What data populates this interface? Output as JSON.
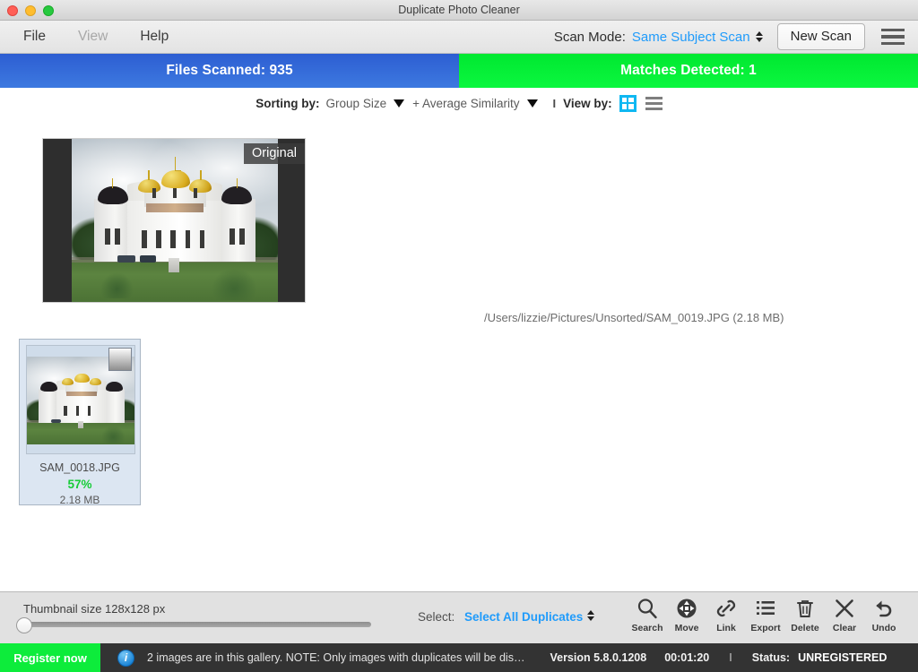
{
  "window": {
    "title": "Duplicate Photo Cleaner"
  },
  "menu": {
    "items": [
      {
        "label": "File",
        "disabled": false
      },
      {
        "label": "View",
        "disabled": true
      },
      {
        "label": "Help",
        "disabled": false
      }
    ],
    "scan_mode_label": "Scan Mode:",
    "scan_mode_value": "Same Subject Scan",
    "new_scan_label": "New Scan"
  },
  "stats": {
    "files_scanned": "Files Scanned: 935",
    "matches_detected": "Matches Detected: 1"
  },
  "sorting": {
    "sorting_label": "Sorting by:",
    "primary": "Group Size",
    "secondary": "+ Average Similarity",
    "separator": "I",
    "view_label": "View by:"
  },
  "preview": {
    "badge": "Original",
    "file_path": "/Users/lizzie/Pictures/Unsorted/SAM_0019.JPG (2.18 MB)"
  },
  "thumbnails": [
    {
      "name": "SAM_0018.JPG",
      "similarity": "57%",
      "size": "2.18 MB"
    }
  ],
  "bottom": {
    "thumbnail_size_label": "Thumbnail size 128x128 px",
    "select_label": "Select:",
    "select_value": "Select All Duplicates",
    "tools": [
      {
        "label": "Search",
        "icon": "search-icon"
      },
      {
        "label": "Move",
        "icon": "move-icon"
      },
      {
        "label": "Link",
        "icon": "link-icon"
      },
      {
        "label": "Export",
        "icon": "export-icon"
      },
      {
        "label": "Delete",
        "icon": "trash-icon"
      },
      {
        "label": "Clear",
        "icon": "close-icon"
      },
      {
        "label": "Undo",
        "icon": "undo-icon"
      }
    ]
  },
  "status": {
    "register_label": "Register now",
    "message": "2 images are in this gallery. NOTE: Only images with duplicates will be dis…",
    "version": "Version 5.8.0.1208",
    "time": "00:01:20",
    "separator": "I",
    "status_label": "Status:",
    "status_value": "UNREGISTERED"
  },
  "colors": {
    "accent_blue": "#1f9bfb",
    "files_bar": "#2d5ed2",
    "matches_bar": "#00e830",
    "similarity_green": "#17cc38",
    "register_green": "#0dec3b"
  }
}
